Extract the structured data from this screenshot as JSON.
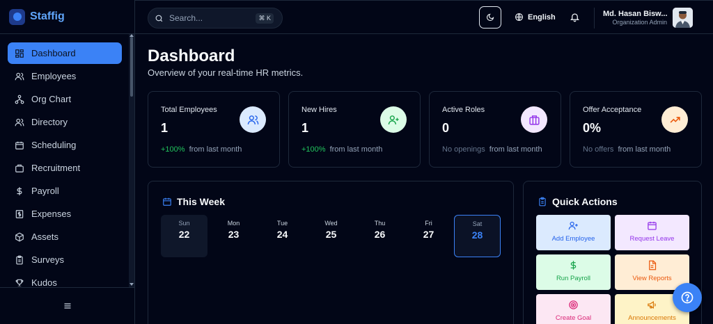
{
  "brand": {
    "name": "Staffig"
  },
  "sidebar": {
    "items": [
      {
        "label": "Dashboard",
        "icon": "dashboard-icon",
        "active": true
      },
      {
        "label": "Employees",
        "icon": "users-icon"
      },
      {
        "label": "Org Chart",
        "icon": "org-chart-icon"
      },
      {
        "label": "Directory",
        "icon": "users-icon"
      },
      {
        "label": "Scheduling",
        "icon": "calendar-icon"
      },
      {
        "label": "Recruitment",
        "icon": "briefcase-icon"
      },
      {
        "label": "Payroll",
        "icon": "dollar-icon"
      },
      {
        "label": "Expenses",
        "icon": "receipt-icon"
      },
      {
        "label": "Assets",
        "icon": "box-icon"
      },
      {
        "label": "Surveys",
        "icon": "clipboard-icon"
      },
      {
        "label": "Kudos",
        "icon": "trophy-icon"
      }
    ],
    "collapse_icon": "menu-icon"
  },
  "header": {
    "search_placeholder": "Search...",
    "search_shortcut": "⌘ K",
    "language": "English",
    "user": {
      "name": "Md. Hasan Biswas",
      "name_display": "Md. Hasan Bisw...",
      "role": "Organization Admin"
    }
  },
  "main": {
    "title": "Dashboard",
    "subtitle": "Overview of your real-time HR metrics.",
    "stats": [
      {
        "label": "Total Employees",
        "value": "1",
        "trend": "+100%",
        "note": "from last month",
        "icon": "users-icon",
        "icon_color": "#2563eb",
        "icon_bg": "#dbeafe"
      },
      {
        "label": "New Hires",
        "value": "1",
        "trend": "+100%",
        "note": "from last month",
        "icon": "user-plus-icon",
        "icon_color": "#16a34a",
        "icon_bg": "#dcfce7"
      },
      {
        "label": "Active Roles",
        "value": "0",
        "muted": "No openings",
        "note": "from last month",
        "icon": "briefcase-icon",
        "icon_color": "#9333ea",
        "icon_bg": "#f3e8ff"
      },
      {
        "label": "Offer Acceptance",
        "value": "0%",
        "muted": "No offers",
        "note": "from last month",
        "icon": "trending-up-icon",
        "icon_color": "#ea580c",
        "icon_bg": "#ffedd5"
      }
    ],
    "week": {
      "title": "This Week",
      "days": [
        {
          "name": "Sun",
          "num": "22",
          "state": "past"
        },
        {
          "name": "Mon",
          "num": "23"
        },
        {
          "name": "Tue",
          "num": "24"
        },
        {
          "name": "Wed",
          "num": "25"
        },
        {
          "name": "Thu",
          "num": "26"
        },
        {
          "name": "Fri",
          "num": "27"
        },
        {
          "name": "Sat",
          "num": "28",
          "state": "today"
        }
      ]
    },
    "quick_actions": {
      "title": "Quick Actions",
      "items": [
        {
          "label": "Add Employee",
          "icon": "user-plus-icon",
          "bg": "#dbeafe",
          "color": "#2563eb"
        },
        {
          "label": "Request Leave",
          "icon": "calendar-icon",
          "bg": "#f3e8ff",
          "color": "#9333ea"
        },
        {
          "label": "Run Payroll",
          "icon": "dollar-icon",
          "bg": "#dcfce7",
          "color": "#16a34a"
        },
        {
          "label": "View Reports",
          "icon": "file-icon",
          "bg": "#ffedd5",
          "color": "#ea580c"
        },
        {
          "label": "Create Goal",
          "icon": "target-icon",
          "bg": "#fce7f3",
          "color": "#db2777"
        },
        {
          "label": "Announcements",
          "icon": "megaphone-icon",
          "bg": "#fef3c7",
          "color": "#d97706"
        }
      ]
    }
  },
  "colors": {
    "accent": "#3b82f6",
    "background": "#020617",
    "border": "#1e293b"
  }
}
